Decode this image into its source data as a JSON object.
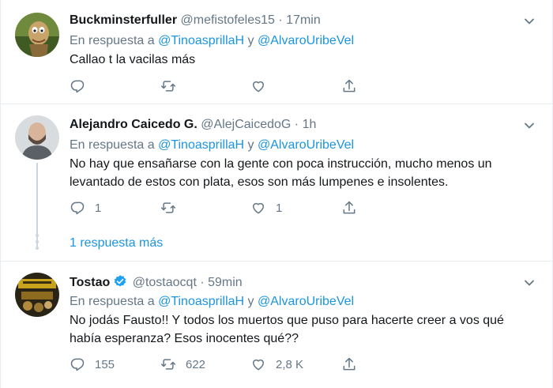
{
  "reply_prefix": "En respuesta a",
  "reply_joiner": "y",
  "time_separator": "·",
  "tweets": [
    {
      "name": "Buckminsterfuller",
      "handle": "@mefistofeles15",
      "time": "17min",
      "mentions": [
        "@TinoasprillaH",
        "@AlvaroUribeVel"
      ],
      "text": "Callao t la vacilas más",
      "counts": {
        "reply": "",
        "retweet": "",
        "like": ""
      },
      "verified": false
    },
    {
      "name": "Alejandro Caicedo G.",
      "handle": "@AlejCaicedoG",
      "time": "1h",
      "mentions": [
        "@TinoasprillaH",
        "@AlvaroUribeVel"
      ],
      "text": "No hay que ensañarse con la gente con poca instrucción, mucho menos un levantado de estos con plata, esos son más lumpenes e insolentes.",
      "counts": {
        "reply": "1",
        "retweet": "",
        "like": "1"
      },
      "verified": false
    },
    {
      "name": "Tostao",
      "handle": "@tostaocqt",
      "time": "59min",
      "mentions": [
        "@TinoasprillaH",
        "@AlvaroUribeVel"
      ],
      "text": "No jodás Fausto!! Y todos los muertos que puso para hacerte creer a vos qué había esperanza? Esos inocentes qué??",
      "counts": {
        "reply": "155",
        "retweet": "622",
        "like": "2,8 K"
      },
      "verified": true
    }
  ],
  "more_replies": "1 respuesta más",
  "colors": {
    "accent": "#1b95e0",
    "text": "#14171a",
    "secondary": "#657786",
    "border": "#e6ecf0",
    "thread": "#ccd6dd"
  },
  "icons": {
    "reply": "reply-icon",
    "retweet": "retweet-icon",
    "like": "heart-icon",
    "share": "share-icon",
    "caret": "chevron-down-icon",
    "verified": "verified-badge-icon"
  }
}
